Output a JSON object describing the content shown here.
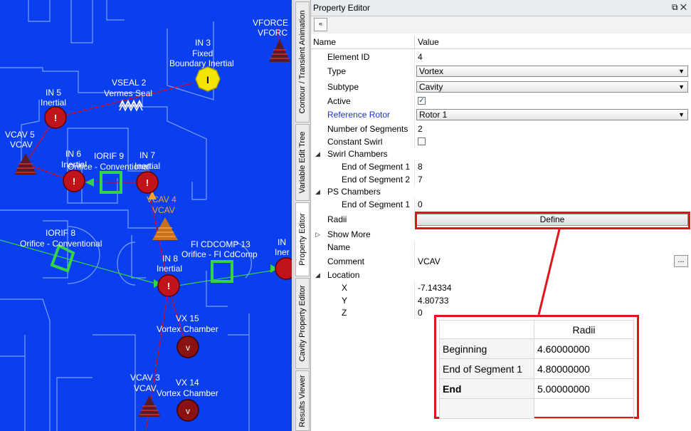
{
  "canvas": {
    "labels": [
      {
        "text": "VFORCE",
        "cls": ""
      },
      {
        "text": "VFORC",
        "cls": ""
      },
      {
        "text": "IN 3",
        "cls": ""
      },
      {
        "text": "Fixed",
        "cls": ""
      },
      {
        "text": "Boundary Inertial",
        "cls": ""
      },
      {
        "text": "VSEAL 2",
        "cls": ""
      },
      {
        "text": "Vermes Seal",
        "cls": ""
      },
      {
        "text": "IN 5",
        "cls": ""
      },
      {
        "text": "Inertial",
        "cls": ""
      },
      {
        "text": "VCAV 5",
        "cls": ""
      },
      {
        "text": "VCAV",
        "cls": ""
      },
      {
        "text": "IN 6",
        "cls": ""
      },
      {
        "text": "Inertial",
        "cls": ""
      },
      {
        "text": "IORIF 9",
        "cls": ""
      },
      {
        "text": "Orifice - Conventional",
        "cls": ""
      },
      {
        "text": "IN 7",
        "cls": ""
      },
      {
        "text": "Inertial",
        "cls": ""
      },
      {
        "text": "VCAV 4",
        "cls": "orange"
      },
      {
        "text": "VCAV",
        "cls": "orange"
      },
      {
        "text": "IORIF 8",
        "cls": ""
      },
      {
        "text": "Orifice - Conventional",
        "cls": ""
      },
      {
        "text": "FI CDCOMP 13",
        "cls": ""
      },
      {
        "text": "Orifice - FI CdComp",
        "cls": ""
      },
      {
        "text": "IN 8",
        "cls": ""
      },
      {
        "text": "Inertial",
        "cls": ""
      },
      {
        "text": "IN",
        "cls": ""
      },
      {
        "text": "Iner",
        "cls": ""
      },
      {
        "text": "VX 15",
        "cls": ""
      },
      {
        "text": "Vortex Chamber",
        "cls": ""
      },
      {
        "text": "VCAV 3",
        "cls": ""
      },
      {
        "text": "VCAV",
        "cls": ""
      },
      {
        "text": "VX 14",
        "cls": ""
      },
      {
        "text": "Vortex Chamber",
        "cls": ""
      }
    ],
    "colors": {
      "background": "#0a3ff0",
      "inertial": "#c0141a",
      "fixed": "#f5e400",
      "orifice": "#35d24a",
      "link": "#c8102e"
    }
  },
  "side_tabs": [
    "Contour / Transient Animation",
    "Variable Edit Tree",
    "Property Editor",
    "Cavity Property Editor",
    "Results Viewer"
  ],
  "panel": {
    "title": "Property Editor",
    "title_buttons": "⧉ ✕",
    "collapse_icon": "«",
    "col_name": "Name",
    "col_value": "Value",
    "rows": {
      "element_id": {
        "name": "Element ID",
        "value": "4"
      },
      "type": {
        "name": "Type",
        "value": "Vortex"
      },
      "subtype": {
        "name": "Subtype",
        "value": "Cavity"
      },
      "active": {
        "name": "Active",
        "value": "✓"
      },
      "reference_rotor": {
        "name": "Reference Rotor",
        "value": "Rotor 1"
      },
      "num_segments": {
        "name": "Number of Segments",
        "value": "2"
      },
      "constant_swirl": {
        "name": "Constant Swirl",
        "value": ""
      },
      "swirl_chambers": {
        "name": "Swirl Chambers"
      },
      "swirl_end1": {
        "name": "End of Segment 1",
        "value": "8"
      },
      "swirl_end2": {
        "name": "End of Segment 2",
        "value": "7"
      },
      "ps_chambers": {
        "name": "PS Chambers"
      },
      "ps_end1": {
        "name": "End of Segment 1",
        "value": "0"
      },
      "radii": {
        "name": "Radii",
        "button": "Define"
      },
      "show_more": {
        "name": "Show More"
      },
      "name": {
        "name": "Name",
        "value": ""
      },
      "comment": {
        "name": "Comment",
        "value": "VCAV",
        "button": "..."
      },
      "location": {
        "name": "Location"
      },
      "x": {
        "name": "X",
        "value": "-7.14334"
      },
      "y": {
        "name": "Y",
        "value": "4.80733"
      },
      "z": {
        "name": "Z",
        "value": "0"
      }
    }
  },
  "radii_popup": {
    "header": "Radii",
    "rows": [
      {
        "label": "Beginning",
        "value": "4.60000000"
      },
      {
        "label": "End of Segment 1",
        "value": "4.80000000"
      },
      {
        "label": "End",
        "value": "5.00000000"
      },
      {
        "label": "",
        "value": ""
      }
    ]
  }
}
